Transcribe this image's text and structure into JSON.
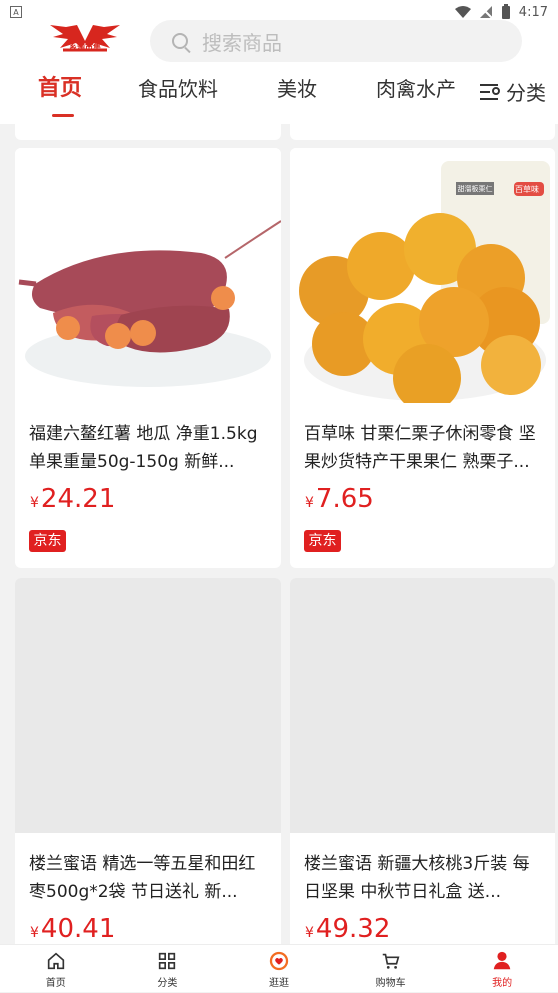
{
  "status_bar": {
    "left_indicator": "A",
    "time": "4:17"
  },
  "logo": {
    "name": "乡淘市集",
    "pinyin": "XIANGTAOSHIJI"
  },
  "search": {
    "placeholder": "搜索商品"
  },
  "tabs": [
    {
      "label": "首页"
    },
    {
      "label": "食品饮料"
    },
    {
      "label": "美妆"
    },
    {
      "label": "肉禽水产"
    }
  ],
  "category": {
    "label": "分类"
  },
  "products": [
    {
      "title": "福建六鳌红薯  地瓜  净重1.5kg 单果重量50g-150g  新鲜...",
      "yen": "¥",
      "price": "24.21",
      "tag": "京东"
    },
    {
      "title": "百草味 甘栗仁栗子休闲零食 坚果炒货特产干果果仁 熟栗子...",
      "yen": "¥",
      "price": "7.65",
      "tag": "京东",
      "package_label": "百草味",
      "package_text": "甜溜板栗仁"
    },
    {
      "title": "楼兰蜜语 精选一等五星和田红枣500g*2袋  节日送礼 新...",
      "yen": "¥",
      "price": "40.41"
    },
    {
      "title": "楼兰蜜语 新疆大核桃3斤装 每日坚果 中秋节日礼盒 送...",
      "yen": "¥",
      "price": "49.32"
    }
  ],
  "bottom_nav": [
    {
      "label": "首页"
    },
    {
      "label": "分类"
    },
    {
      "label": "逛逛"
    },
    {
      "label": "购物车"
    },
    {
      "label": "我的"
    }
  ],
  "colors": {
    "brand": "#d93025",
    "price": "#e02020",
    "background": "#f2f2f2"
  }
}
